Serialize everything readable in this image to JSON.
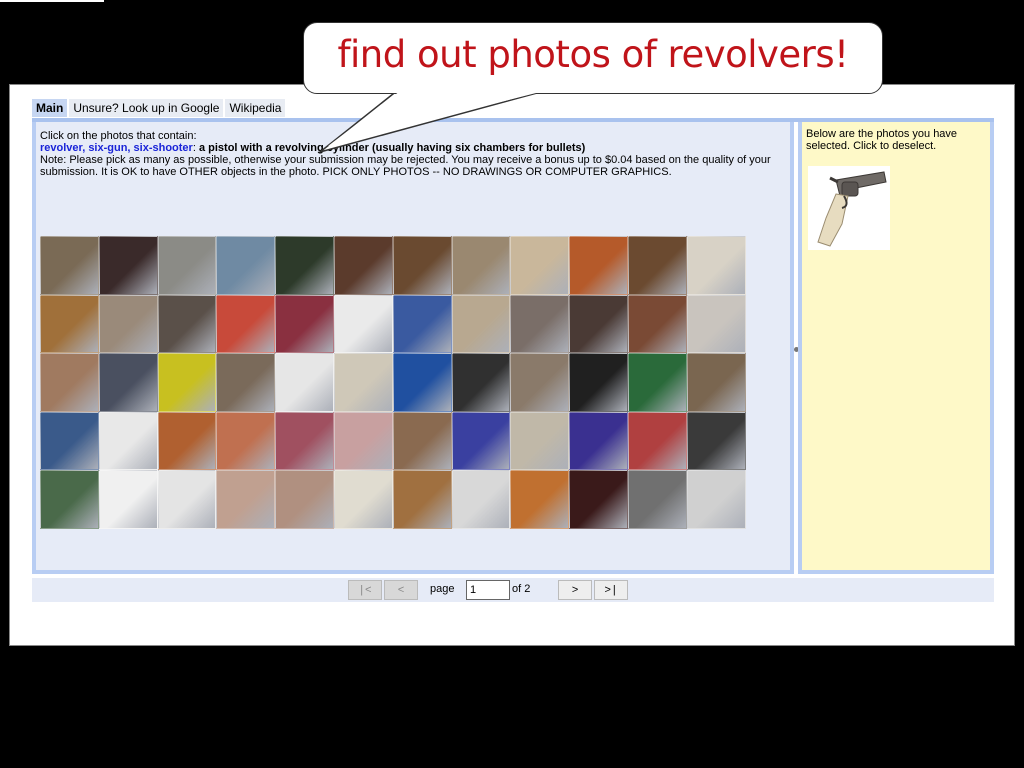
{
  "callout": {
    "text": "find out photos of revolvers!"
  },
  "tabs": [
    {
      "label": "Main",
      "active": true
    },
    {
      "label": "Unsure? Look up in Google",
      "active": false
    },
    {
      "label": "Wikipedia",
      "active": false
    }
  ],
  "instructions": {
    "line1": "Click on the photos that contain:",
    "keywords": "revolver, six-gun, six-shooter",
    "separator": ": ",
    "definition": "a pistol with a revolving cylinder (usually having six chambers for bullets)",
    "note": "Note: Please pick as many as possible, otherwise your submission may be rejected. You may receive a bonus up to $0.04 based on the quality of your submission. It is OK to have OTHER objects in the photo. PICK ONLY PHOTOS -- NO DRAWINGS OR COMPUTER GRAPHICS."
  },
  "sidebar": {
    "text": "Below are the photos you have selected. Click to deselect."
  },
  "pager": {
    "first": "|<",
    "prev": "<",
    "page_label": "page",
    "page_value": "1",
    "of_label": "of 2",
    "next": ">",
    "last": ">|"
  },
  "colors": {
    "callout_text": "#c0141a",
    "keyword": "#1a24d8",
    "panel_border": "#b8cdf3",
    "main_bg": "#e6ebf7",
    "sidebar_bg": "#fef9c8"
  },
  "photo_grid": {
    "columns": 12,
    "rows": 5,
    "colors": [
      "#7a6a55",
      "#3a2a2a",
      "#8b8b86",
      "#6f8aa3",
      "#2d3a2a",
      "#5b3b2c",
      "#6a4a30",
      "#9a8870",
      "#c9b79b",
      "#b55a2a",
      "#6b4a30",
      "#d8d2c6",
      "#a0703a",
      "#9a8a7a",
      "#5a5049",
      "#c84a3a",
      "#8a3040",
      "#eaeaea",
      "#3a5aa0",
      "#b8a890",
      "#7a6e68",
      "#4a3a35",
      "#7a4a35",
      "#c9c4be",
      "#a07a60",
      "#4a5060",
      "#c8c020",
      "#7a6a5a",
      "#e6e6e6",
      "#cfc8b8",
      "#2050a0",
      "#303030",
      "#8a7a6a",
      "#202020",
      "#2a6a3a",
      "#7a6650",
      "#3a5a8a",
      "#e8e8e8",
      "#b06030",
      "#c07050",
      "#a05060",
      "#c8a0a0",
      "#8a6a50",
      "#3a40a0",
      "#c0b8a8",
      "#3a3090",
      "#b04040",
      "#3a3a3a",
      "#4a6a4a",
      "#f0f0f0",
      "#e4e4e4",
      "#c0a090",
      "#b09080",
      "#e0dcd0",
      "#a07040",
      "#d8d8d8",
      "#c07030",
      "#3a1a1a",
      "#707070",
      "#d0d0d0"
    ]
  }
}
